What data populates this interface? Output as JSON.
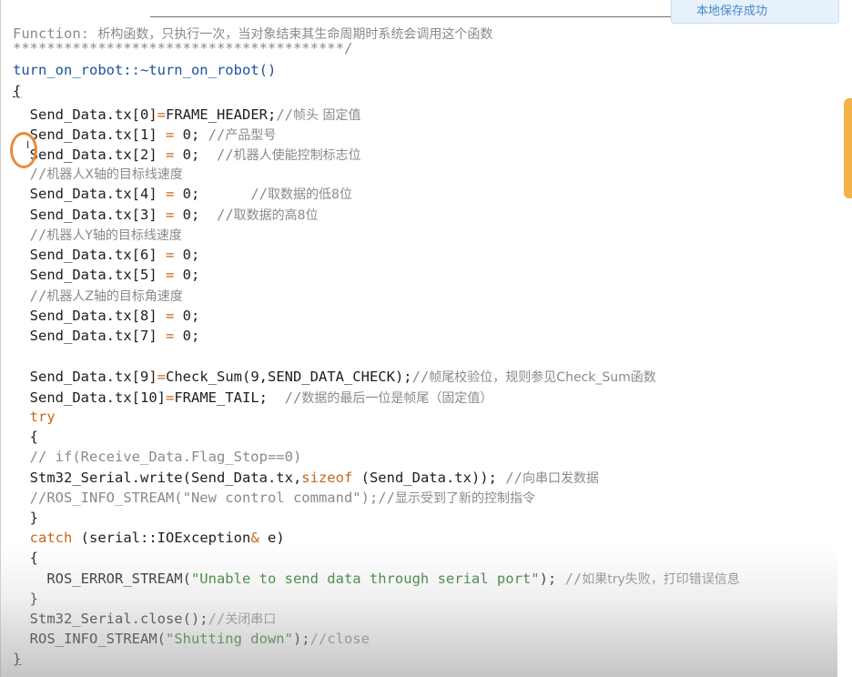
{
  "toast": {
    "text": "本地保存成功"
  },
  "code": {
    "header": {
      "label": "Function:",
      "desc": "析构函数，只执行一次，当对象结束其生命周期时系统会调用这个函数",
      "stars": "***************************************/"
    },
    "sig": "turn_on_robot::~turn_on_robot()",
    "open_brace": "{",
    "l1": {
      "a": "Send_Data.tx[0]",
      "op": "=",
      "b": "FRAME_HEADER;",
      "c": "//",
      "cz": "帧头 固定值"
    },
    "l2": {
      "a": "Send_Data.tx[1] ",
      "op": "=",
      "b": " 0; ",
      "c": "//",
      "cz": "产品型号"
    },
    "l3": {
      "a": "Send_Data.tx[2] ",
      "op": "=",
      "b": " 0;  ",
      "c": "//",
      "cz": "机器人使能控制标志位"
    },
    "l4": {
      "c": "//",
      "cz": "机器人X轴的目标线速度"
    },
    "l5": {
      "a": "Send_Data.tx[4] ",
      "op": "=",
      "b": " 0;      ",
      "c": "//",
      "cz": "取数据的低8位"
    },
    "l6": {
      "a": "Send_Data.tx[3] ",
      "op": "=",
      "b": " 0;  ",
      "c": "//",
      "cz": "取数据的高8位"
    },
    "l7": {
      "c": "//",
      "cz": "机器人Y轴的目标线速度"
    },
    "l8": {
      "a": "Send_Data.tx[6] ",
      "op": "=",
      "b": " 0;"
    },
    "l9": {
      "a": "Send_Data.tx[5] ",
      "op": "=",
      "b": " 0;"
    },
    "l10": {
      "c": "//",
      "cz": "机器人Z轴的目标角速度"
    },
    "l11": {
      "a": "Send_Data.tx[8] ",
      "op": "=",
      "b": " 0;"
    },
    "l12": {
      "a": "Send_Data.tx[7] ",
      "op": "=",
      "b": " 0;"
    },
    "l13": {
      "a": "Send_Data.tx[9]",
      "op": "=",
      "b": "Check_Sum(9,SEND_DATA_CHECK);",
      "c": "//",
      "cz": "帧尾校验位，规则参见Check_Sum函数"
    },
    "l14": {
      "a": "Send_Data.tx[10]",
      "op": "=",
      "b": "FRAME_TAIL;  ",
      "c": "//",
      "cz": "数据的最后一位是帧尾（固定值）"
    },
    "l15": {
      "kw": "try"
    },
    "l16": {
      "t": "{"
    },
    "l17": {
      "c": "// if(Receive_Data.Flag_Stop==0)"
    },
    "l18": {
      "a": "Stm32_Serial.write(Send_Data.tx,",
      "kw": "sizeof",
      "b": " (Send_Data.tx)); ",
      "c": "//",
      "cz": "向串口发数据"
    },
    "l19": {
      "c": "//ROS_INFO_STREAM(\"New control command\");//",
      "cz": "显示受到了新的控制指令"
    },
    "l20": {
      "t": "}"
    },
    "l21": {
      "kw": "catch",
      "a": " (serial::IOException",
      "op": "&",
      "b": " e)"
    },
    "l22": {
      "t": "{"
    },
    "l23": {
      "a": "ROS_ERROR_STREAM(",
      "s": "\"Unable to send data through serial port\"",
      "b": "); ",
      "c": "//",
      "cz": "如果try失败，打印错误信息"
    },
    "l24": {
      "t": "}"
    },
    "l25": {
      "a": "Stm32_Serial.close();",
      "c": "//",
      "cz": "关闭串口"
    },
    "l26": {
      "a": "ROS_INFO_STREAM(",
      "s": "\"Shutting down\"",
      "b": ");",
      "c": "//close"
    },
    "close_brace": "}"
  }
}
